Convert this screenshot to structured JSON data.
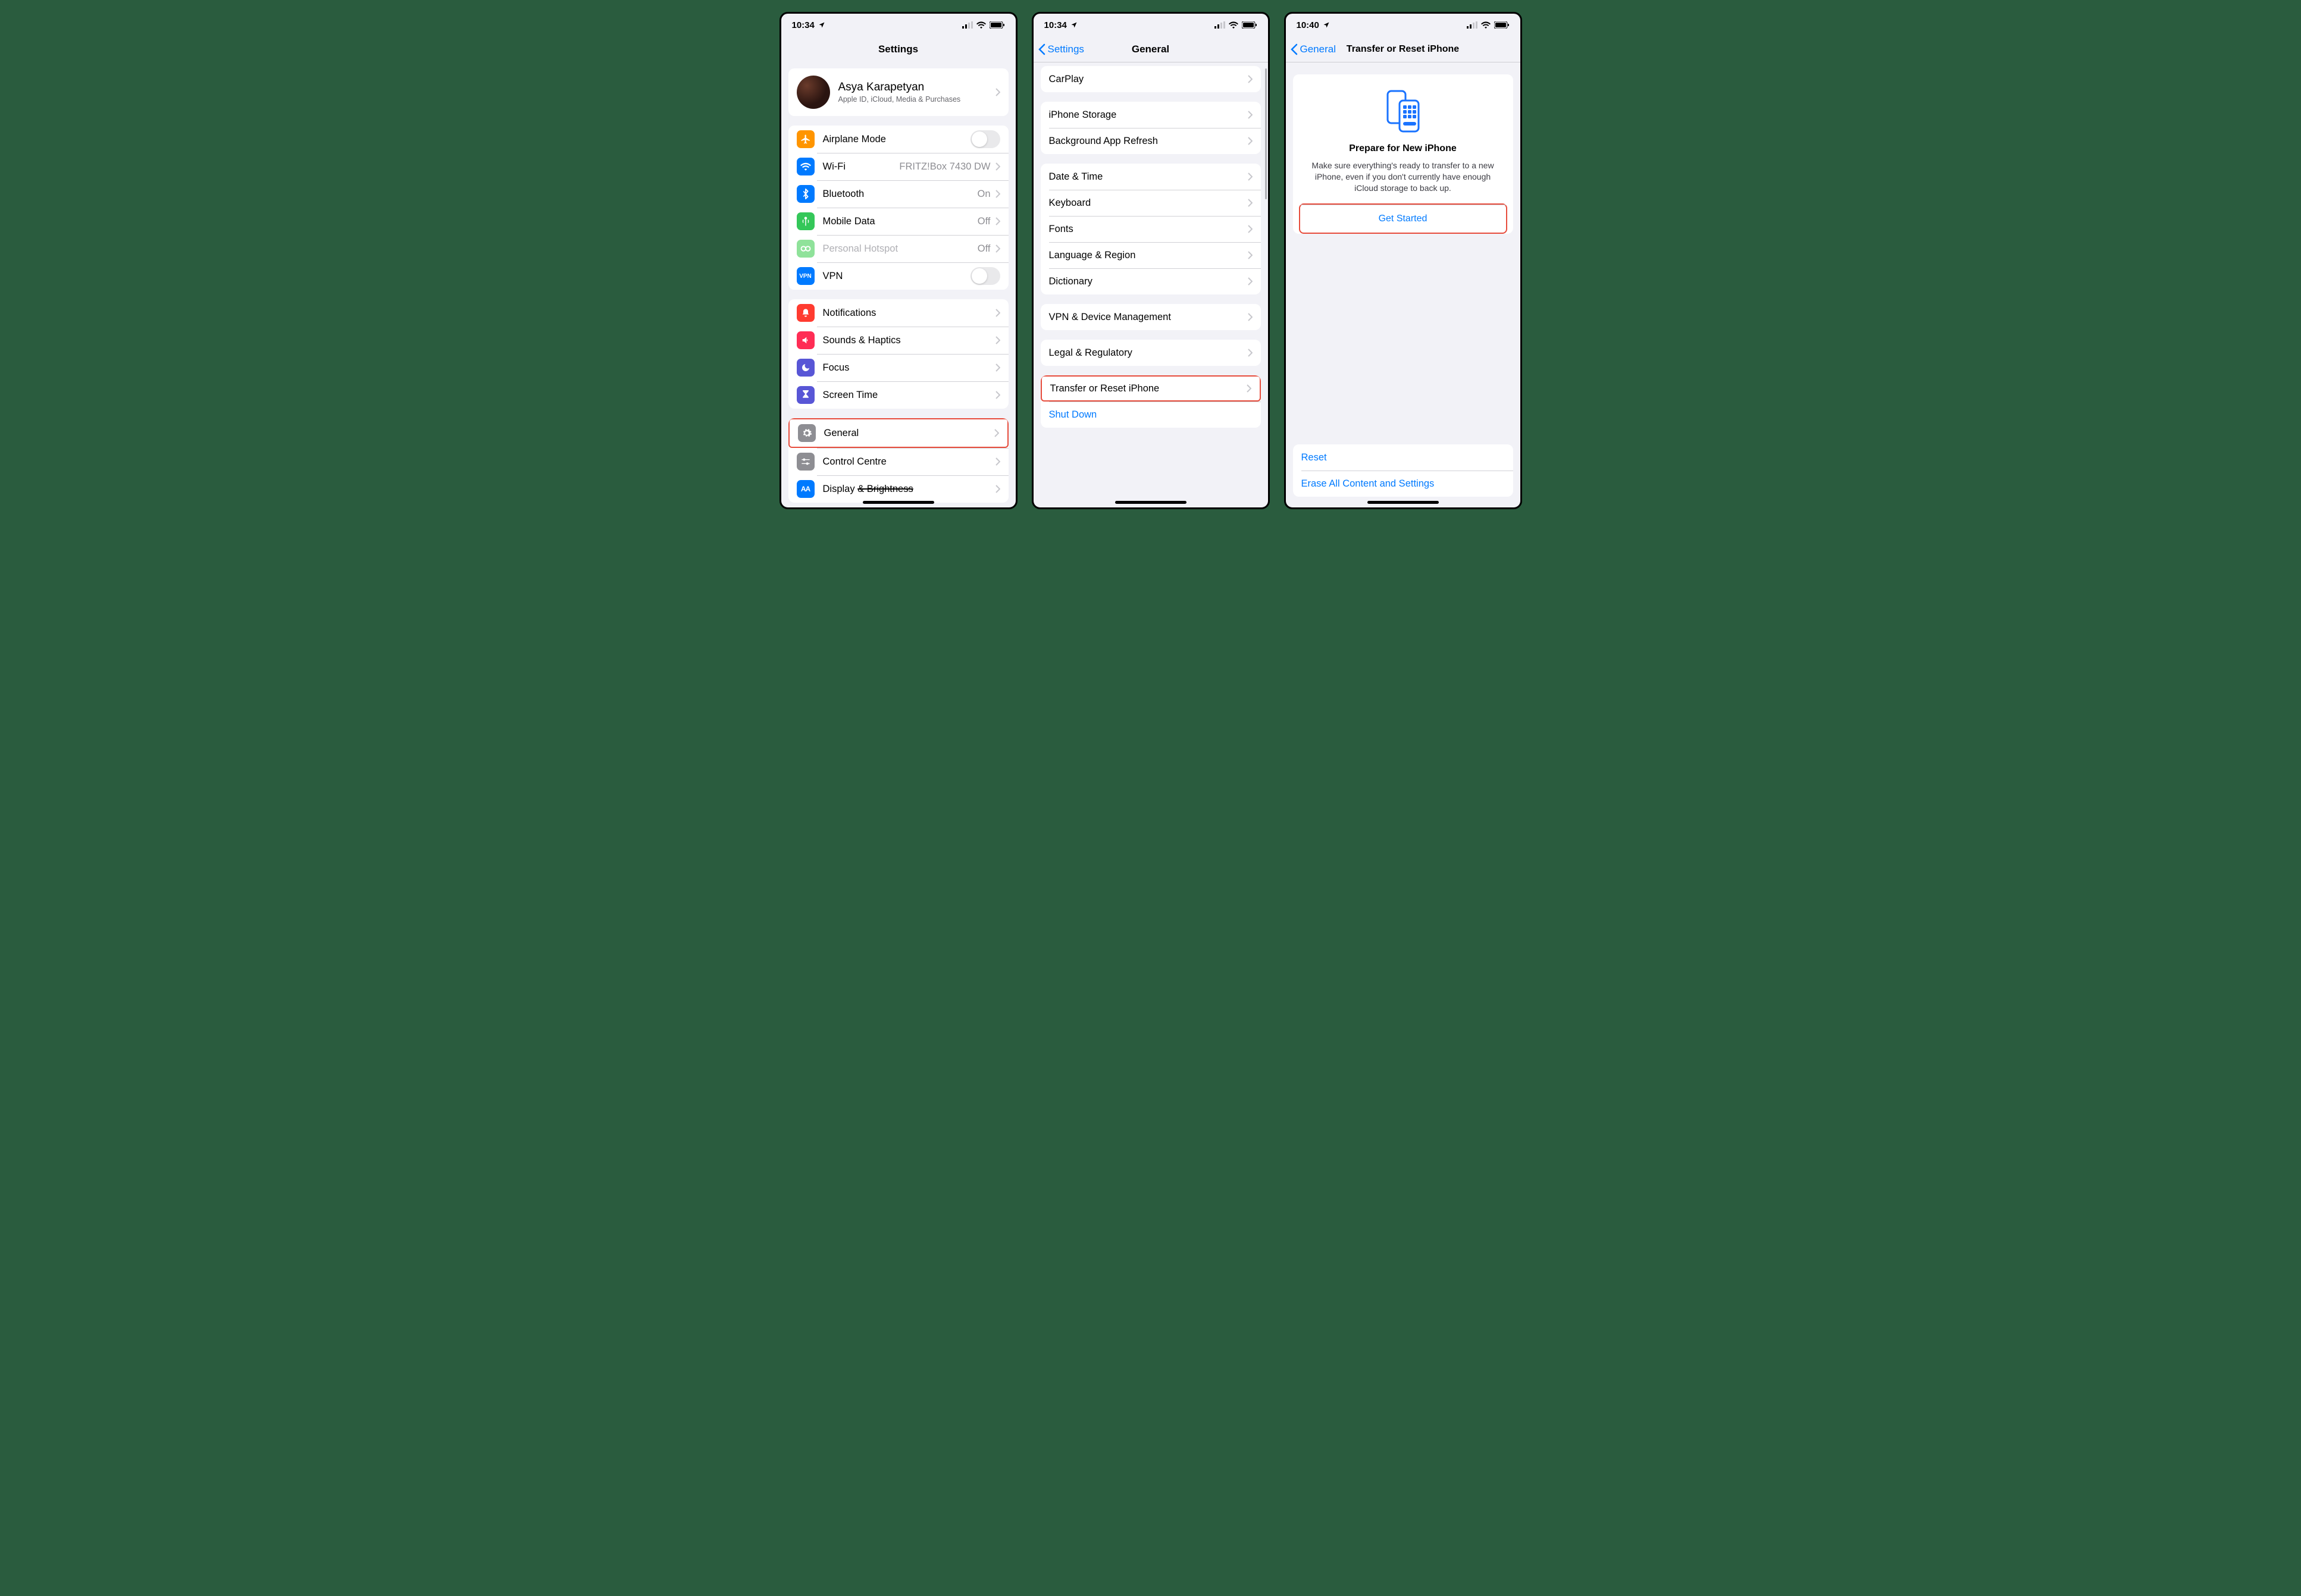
{
  "phone1": {
    "time": "10:34",
    "title": "Settings",
    "profile": {
      "name": "Asya Karapetyan",
      "sub": "Apple ID, iCloud, Media & Purchases"
    },
    "rows": {
      "airplane": "Airplane Mode",
      "wifi": "Wi-Fi",
      "wifi_detail": "FRITZ!Box 7430 DW",
      "bluetooth": "Bluetooth",
      "bluetooth_detail": "On",
      "mobile": "Mobile Data",
      "mobile_detail": "Off",
      "hotspot": "Personal Hotspot",
      "hotspot_detail": "Off",
      "vpn": "VPN",
      "notifications": "Notifications",
      "sounds": "Sounds & Haptics",
      "focus": "Focus",
      "screentime": "Screen Time",
      "general": "General",
      "control": "Control Centre",
      "display": "Display & Brightness"
    }
  },
  "phone2": {
    "time": "10:34",
    "back": "Settings",
    "title": "General",
    "rows": {
      "carplay": "CarPlay",
      "storage": "iPhone Storage",
      "bgrefresh": "Background App Refresh",
      "datetime": "Date & Time",
      "keyboard": "Keyboard",
      "fonts": "Fonts",
      "lang": "Language & Region",
      "dict": "Dictionary",
      "vpnmgmt": "VPN & Device Management",
      "legal": "Legal & Regulatory",
      "transfer": "Transfer or Reset iPhone",
      "shutdown": "Shut Down"
    }
  },
  "phone3": {
    "time": "10:40",
    "back": "General",
    "title": "Transfer or Reset iPhone",
    "hero": {
      "heading": "Prepare for New iPhone",
      "body": "Make sure everything's ready to transfer to a new iPhone, even if you don't currently have enough iCloud storage to back up.",
      "cta": "Get Started"
    },
    "reset": "Reset",
    "erase": "Erase All Content and Settings"
  }
}
